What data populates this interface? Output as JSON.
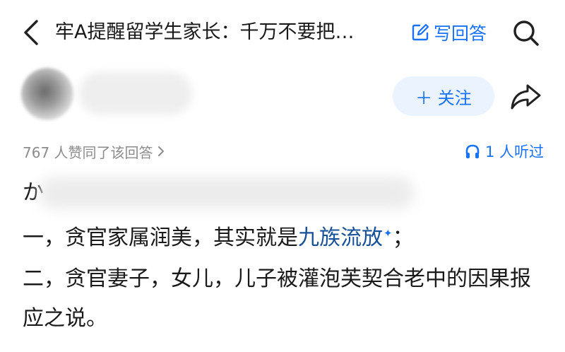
{
  "header": {
    "title": "牢A提醒留学生家长：千万不要把…",
    "write_answer_label": "写回答"
  },
  "author": {
    "follow_label": "＋ 关注"
  },
  "meta": {
    "vote_text": "767 人赞同了该回答",
    "listen_text": "1 人听过"
  },
  "content": {
    "first_char": "か",
    "line1_prefix": "一，贪官家属润美，其实就是",
    "line1_link": "九族流放",
    "line1_suffix": "；",
    "line2": "二，贪官妻子，女儿，儿子被灌泡芙契合老中的因果报应之说。"
  },
  "colors": {
    "accent": "#1772f6",
    "link": "#175199",
    "muted": "#8c8c8c",
    "follow_bg": "#ebf3fe"
  },
  "icons": {
    "back": "chevron-left-icon",
    "write": "edit-icon",
    "search": "search-icon",
    "share": "share-icon",
    "vote_chevron": "chevron-right-icon",
    "listen": "headphones-icon",
    "sparkle": "sparkle-icon"
  }
}
